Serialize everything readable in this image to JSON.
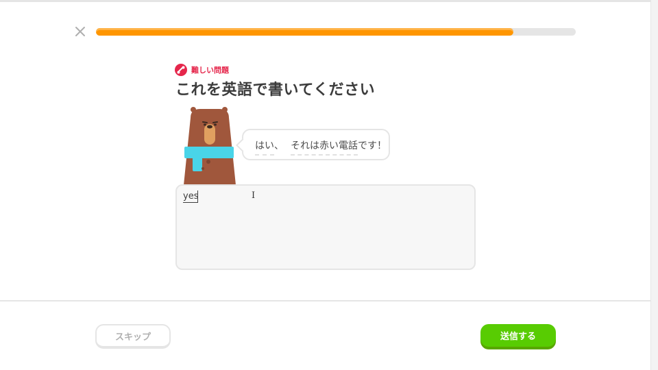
{
  "header": {
    "close_icon": "close-icon",
    "progress_fraction": 0.87
  },
  "challenge": {
    "badge_icon": "flex-arm-icon",
    "badge_label": "難しい問題",
    "badge_color": "#e5264b",
    "title": "これを英語で書いてください"
  },
  "speech": {
    "tokens": [
      "はい",
      "、",
      "それは赤い電話",
      "です！"
    ]
  },
  "answer": {
    "value": "yes"
  },
  "footer": {
    "skip_label": "スキップ",
    "submit_label": "送信する",
    "submit_color": "#58cc02"
  },
  "colors": {
    "accent_orange": "#ff9600",
    "track_gray": "#e5e5e5"
  }
}
